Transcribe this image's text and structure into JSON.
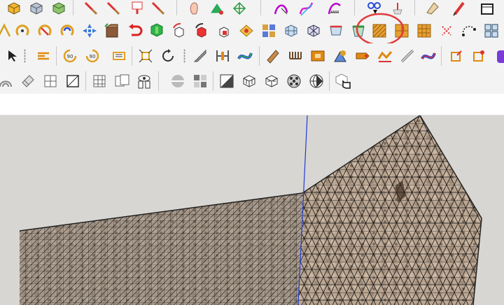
{
  "app": "SketchUp",
  "toolbar_rows": [
    {
      "id": "row1",
      "icons": [
        "box-icon",
        "3d-box-icon",
        "paint-bucket-icon",
        "hammer-red-icon",
        "hammer-red-icon",
        "paint-red-icon",
        "hammer-red-icon",
        "finger-icon",
        "sandbox-icon",
        "network-icon",
        "curve-edit-icon",
        "curve-pink-icon",
        "tape-icon",
        "bike-icon",
        "scale-icon",
        "pencil-icon",
        "box-outline-icon"
      ]
    },
    {
      "id": "row2",
      "icons": [
        "triangle-icon",
        "loop-orange-icon",
        "loop-red-icon",
        "loop-blue-icon",
        "move-gizmo-icon",
        "crate-icon",
        "undo-red-icon",
        "tree-icon",
        "rotate-box-icon",
        "rotate-red-box-icon",
        "box-red-icon",
        "rug-icon",
        "cube-group-icon",
        "grid-cube-icon",
        "grid-blue-icon",
        "grid-red-icon",
        "cup-icon",
        "hatch-tile-icon",
        "hatch-tile-icon",
        "grid-tile-icon",
        "dots-x-icon",
        "circle-arc-icon",
        "cubes-blue-icon"
      ]
    },
    {
      "id": "row3",
      "icons": [
        "select-icon",
        "align-icon",
        "rotate-90-icon",
        "rotate-90-icon",
        "panel-icon",
        "shrink-icon",
        "circle-arrow-icon",
        "blade-icon",
        "frame-icon",
        "path-icon",
        "prism-icon",
        "comb-icon",
        "box-orange-icon",
        "cone-icon",
        "tag-icon",
        "extrude-icon",
        "path-icon",
        "cube-red-icon",
        "cube-red-icon"
      ]
    },
    {
      "id": "row4",
      "icons": [
        "dome-icon",
        "eraser-icon",
        "cube-wire-icon",
        "square-select-icon",
        "grid-icon",
        "cubes-icon",
        "eye-icon",
        "sphere-icon",
        "checker-icon",
        "section-icon",
        "cube-wire-icon",
        "cube-wire-icon",
        "sphere-checker-icon",
        "sphere-icon",
        "cube-hand-icon"
      ]
    }
  ],
  "highlight": {
    "color": "#e23b3b",
    "target": "hatch-tile-icon"
  },
  "viewport": {
    "background": "#d7d6d2",
    "axis_color": "#1f3bd6",
    "mesh_color": "#111111",
    "texture_color": "#b9a591"
  }
}
